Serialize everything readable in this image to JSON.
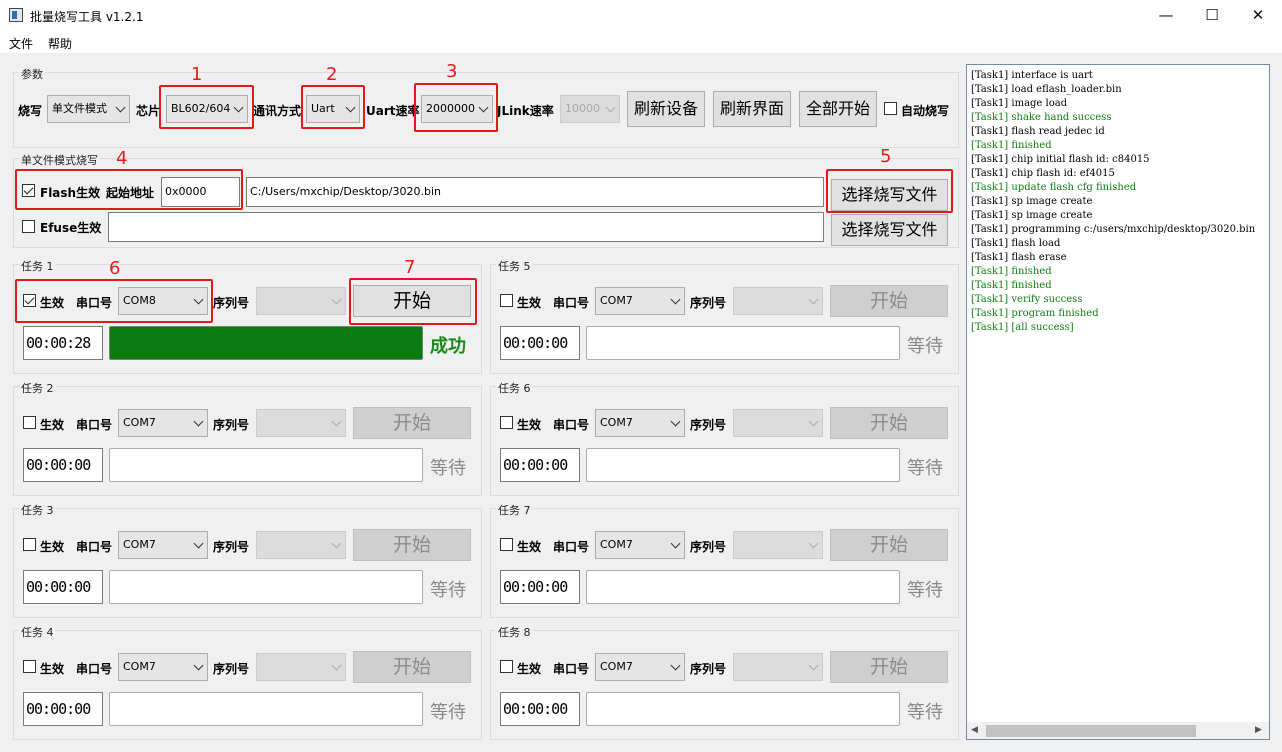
{
  "window": {
    "title": "批量烧写工具 v1.2.1",
    "minimize": "—",
    "maximize": "☐",
    "close": "✕"
  },
  "menu": {
    "file": "文件",
    "help": "帮助"
  },
  "params": {
    "group_title": "参数",
    "burn_label": "烧写",
    "burn_mode": "单文件模式",
    "chip_label": "芯片",
    "chip_value": "BL602/604",
    "comm_label": "通讯方式",
    "comm_value": "Uart",
    "uart_rate_label": "Uart速率",
    "uart_rate_value": "2000000",
    "jlink_rate_label": "JLink速率",
    "jlink_rate_value": "10000",
    "refresh_device": "刷新设备",
    "refresh_ui": "刷新界面",
    "start_all": "全部开始",
    "auto_burn": "自动烧写"
  },
  "single_file": {
    "group_title": "单文件模式烧写",
    "flash_enable": "Flash生效",
    "start_addr_label": "起始地址",
    "start_addr": "0x0000",
    "flash_path": "C:/Users/mxchip/Desktop/3020.bin",
    "choose_file": "选择烧写文件",
    "efuse_enable": "Efuse生效",
    "efuse_path": "",
    "choose_file2": "选择烧写文件"
  },
  "task_labels": {
    "enable": "生效",
    "port": "串口号",
    "serial": "序列号",
    "start": "开始"
  },
  "tasks": [
    {
      "title": "任务 1",
      "enabled": true,
      "port": "COM8",
      "time": "00:00:28",
      "progress": 1.0,
      "status": "成功"
    },
    {
      "title": "任务 2",
      "enabled": false,
      "port": "COM7",
      "time": "00:00:00",
      "progress": 0,
      "status": "等待"
    },
    {
      "title": "任务 3",
      "enabled": false,
      "port": "COM7",
      "time": "00:00:00",
      "progress": 0,
      "status": "等待"
    },
    {
      "title": "任务 4",
      "enabled": false,
      "port": "COM7",
      "time": "00:00:00",
      "progress": 0,
      "status": "等待"
    },
    {
      "title": "任务 5",
      "enabled": false,
      "port": "COM7",
      "time": "00:00:00",
      "progress": 0,
      "status": "等待"
    },
    {
      "title": "任务 6",
      "enabled": false,
      "port": "COM7",
      "time": "00:00:00",
      "progress": 0,
      "status": "等待"
    },
    {
      "title": "任务 7",
      "enabled": false,
      "port": "COM7",
      "time": "00:00:00",
      "progress": 0,
      "status": "等待"
    },
    {
      "title": "任务 8",
      "enabled": false,
      "port": "COM7",
      "time": "00:00:00",
      "progress": 0,
      "status": "等待"
    }
  ],
  "annotations": [
    "1",
    "2",
    "3",
    "4",
    "5",
    "6",
    "7"
  ],
  "log": [
    {
      "text": "[Task1] interface is uart",
      "green": false
    },
    {
      "text": "[Task1] load eflash_loader.bin",
      "green": false
    },
    {
      "text": "[Task1] image load",
      "green": false
    },
    {
      "text": "[Task1] shake hand success",
      "green": true
    },
    {
      "text": "[Task1] flash read jedec id",
      "green": false
    },
    {
      "text": "[Task1] finished",
      "green": true
    },
    {
      "text": "[Task1] chip initial flash id: c84015",
      "green": false
    },
    {
      "text": "[Task1] chip flash id: ef4015",
      "green": false
    },
    {
      "text": "[Task1] update flash cfg finished",
      "green": true
    },
    {
      "text": "[Task1] sp image create",
      "green": false
    },
    {
      "text": "[Task1] sp image create",
      "green": false
    },
    {
      "text": "[Task1] programming c:/users/mxchip/desktop/3020.bin",
      "green": false
    },
    {
      "text": "[Task1] flash load",
      "green": false
    },
    {
      "text": "[Task1] flash erase",
      "green": false
    },
    {
      "text": "[Task1] finished",
      "green": true
    },
    {
      "text": "[Task1] finished",
      "green": true
    },
    {
      "text": "[Task1] verify success",
      "green": true
    },
    {
      "text": "[Task1] program finished",
      "green": true
    },
    {
      "text": "[Task1] [all success]",
      "green": true
    }
  ],
  "colors": {
    "annotation_red": "#e11b1b",
    "success_green": "#0b7b11",
    "log_green": "#127d12"
  }
}
